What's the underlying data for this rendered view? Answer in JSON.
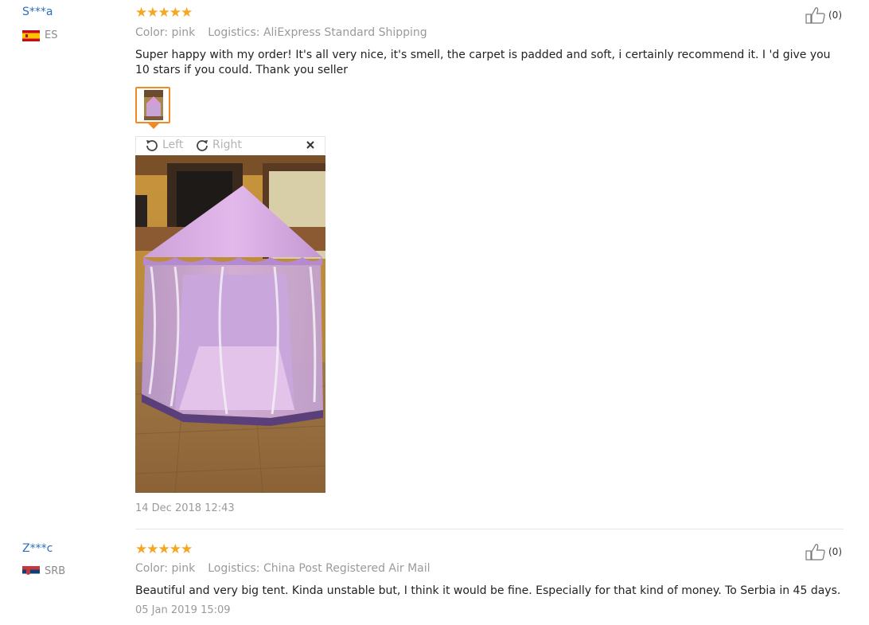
{
  "reviews": [
    {
      "user": "S***a",
      "country_code": "ES",
      "rating": 5,
      "color": "Color: pink",
      "logistics": "Logistics: AliExpress Standard Shipping",
      "text": "Super happy with my order! It's all very nice, it's smell, the carpet is padded and soft, i certainly recommend it. I 'd give you 10 stars if you could. Thank you seller",
      "likes": "(0)",
      "date": "14 Dec 2018 12:43",
      "viewer": {
        "rotate_left": "Left",
        "rotate_right": "Right"
      }
    },
    {
      "user": "Z***c",
      "country_code": "SRB",
      "rating": 5,
      "color": "Color: pink",
      "logistics": "Logistics: China Post Registered Air Mail",
      "text": "Beautiful and very big tent. Kinda unstable but, I think it would be fine. Especially for that kind of money. To Serbia in 45 days.",
      "likes": "(0)",
      "date": "05 Jan 2019 15:09"
    }
  ],
  "colors": {
    "accent": "#f08a24",
    "star": "#f5a623",
    "link": "#2a6fbf",
    "muted": "#9a9a9a"
  }
}
